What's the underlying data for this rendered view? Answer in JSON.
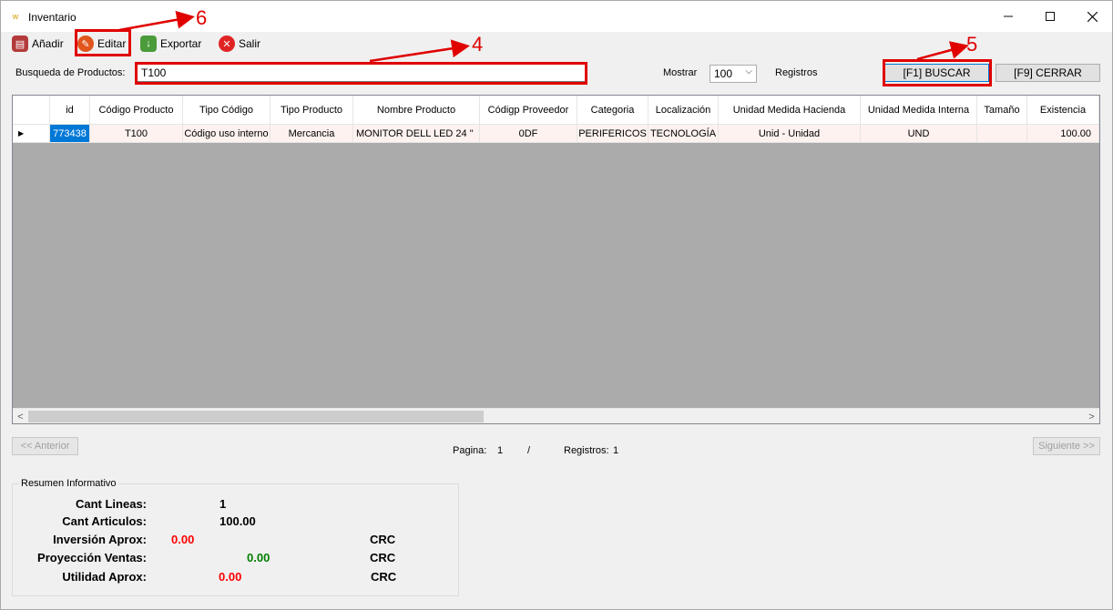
{
  "window": {
    "title": "Inventario"
  },
  "toolbar": {
    "add_label": "Añadir",
    "edit_label": "Editar",
    "export_label": "Exportar",
    "exit_label": "Salir"
  },
  "search": {
    "label": "Busqueda de Productos:",
    "value": "T100",
    "mostrar_label": "Mostrar",
    "mostrar_value": "100",
    "registros_label": "Registros",
    "buscar_label": "[F1] BUSCAR",
    "cerrar_label": "[F9] CERRAR"
  },
  "grid": {
    "columns": [
      "id",
      "Código Producto",
      "Tipo Código",
      "Tipo Producto",
      "Nombre Producto",
      "Códigp Proveedor",
      "Categoria",
      "Localización",
      "Unidad Medida Hacienda",
      "Unidad Medida Interna",
      "Tamaño",
      "Existencia"
    ],
    "rows": [
      [
        "773438",
        "T100",
        "Código uso interno",
        "Mercancia",
        "MONITOR DELL  LED 24 \"",
        "0DF",
        "PERIFERICOS",
        "TECNOLOGÍA",
        "Unid - Unidad",
        "UND",
        "",
        "100.00"
      ]
    ]
  },
  "pager": {
    "prev_label": "<< Anterior",
    "next_label": "Siguiente >>",
    "page_label": "Pagina:",
    "page_value": "1",
    "separator": "/",
    "records_label": "Registros:",
    "records_value": "1"
  },
  "summary": {
    "legend": "Resumen Informativo",
    "cant_lineas_label": "Cant Lineas:",
    "cant_lineas_value": "1",
    "cant_articulos_label": "Cant Articulos:",
    "cant_articulos_value": "100.00",
    "inversion_label": "Inversión Aprox:",
    "inversion_value": "0.00",
    "inversion_currency": "CRC",
    "proyeccion_label": "Proyección Ventas:",
    "proyeccion_value": "0.00",
    "proyeccion_currency": "CRC",
    "utilidad_label": "Utilidad Aprox:",
    "utilidad_value": "0.00",
    "utilidad_currency": "CRC"
  },
  "annotations": {
    "edit_number": "6",
    "search_number": "4",
    "buscar_number": "5",
    "color": "#e00000"
  }
}
